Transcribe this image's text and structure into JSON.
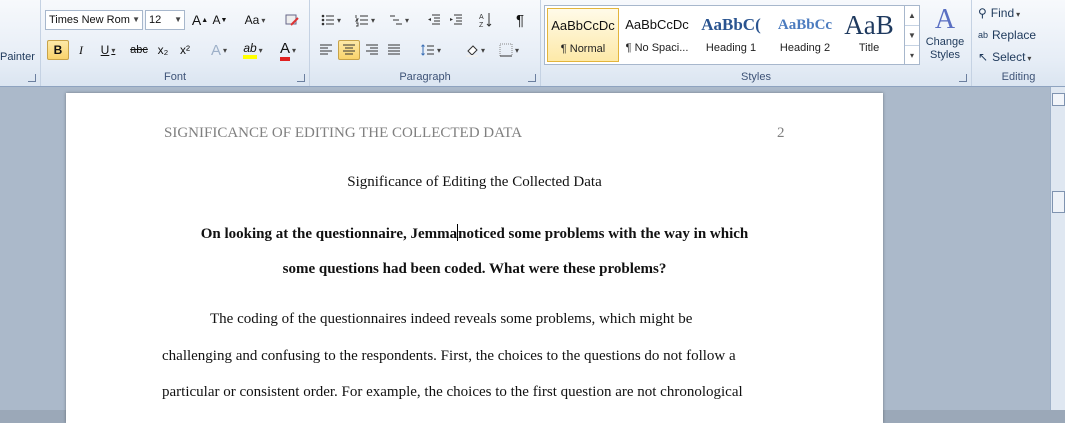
{
  "ribbon": {
    "clipboard": {
      "painter_label": "Painter"
    },
    "font": {
      "label": "Font",
      "font_name": "Times New Rom",
      "font_size": "12",
      "grow": "A",
      "shrink": "A",
      "change_case": "Aa",
      "bold": "B",
      "italic": "I",
      "underline": "U",
      "strike": "abc",
      "subscript": "x₂",
      "superscript": "x²",
      "text_effects": "A",
      "highlight": "ab",
      "font_color": "A"
    },
    "paragraph": {
      "label": "Paragraph",
      "pilcrow": "¶"
    },
    "styles": {
      "label": "Styles",
      "items": [
        {
          "sample": "AaBbCcDc",
          "name": "¶ Normal"
        },
        {
          "sample": "AaBbCcDc",
          "name": "¶ No Spaci..."
        },
        {
          "sample": "AaBbC(",
          "name": "Heading 1"
        },
        {
          "sample": "AaBbCc",
          "name": "Heading 2"
        },
        {
          "sample": "AaB",
          "name": "Title"
        }
      ],
      "change_styles": "Change Styles"
    },
    "editing": {
      "label": "Editing",
      "find": "Find",
      "replace": "Replace",
      "select": "Select"
    }
  },
  "document": {
    "header_title": "SIGNIFICANCE OF EDITING THE COLLECTED DATA",
    "header_page": "2",
    "title": "Significance of Editing the Collected Data",
    "question_line1_a": "On looking at the questionnaire, Jemma",
    "question_line1_b": "noticed some problems with the way in which",
    "question_line2": "some questions had been coded. What were these problems?",
    "body_lines": [
      "The coding of the questionnaires indeed reveals some problems, which might be",
      "challenging  and confusing to the respondents. First, the choices to the questions  do not follow a",
      "particular or consistent order. For example, the choices to the first question are not chronological"
    ]
  },
  "colors": {
    "ribbon_accent": "#1e395b",
    "selected_button": "#f9d36b",
    "highlight_yellow": "#ffff00",
    "font_color_red": "#e02020",
    "workspace": "#abb9ca"
  }
}
